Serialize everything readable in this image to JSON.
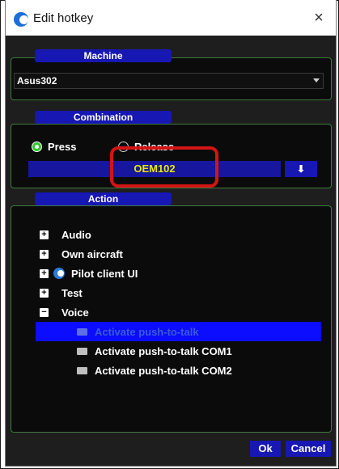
{
  "window": {
    "title": "Edit hotkey",
    "close_symbol": "×"
  },
  "machine": {
    "group_title": "Machine",
    "selected": "Asus302"
  },
  "combination": {
    "group_title": "Combination",
    "press_label": "Press",
    "release_label": "Release",
    "press_checked": true,
    "key_value": "OEM102",
    "select_key_symbol": "⬇"
  },
  "action": {
    "group_title": "Action",
    "tree": [
      {
        "label": "Audio",
        "toggle": "+"
      },
      {
        "label": "Own aircraft",
        "toggle": "+"
      },
      {
        "label": "Pilot client UI",
        "toggle": "+",
        "icon": "app-icon"
      },
      {
        "label": "Test",
        "toggle": "+"
      },
      {
        "label": "Voice",
        "toggle": "−"
      },
      {
        "label": "Activate push-to-talk",
        "icon": "keyboard-icon",
        "selected": true
      },
      {
        "label": "Activate push-to-talk COM1",
        "icon": "keyboard-icon"
      },
      {
        "label": "Activate push-to-talk COM2",
        "icon": "keyboard-icon"
      }
    ]
  },
  "buttons": {
    "ok": "Ok",
    "cancel": "Cancel"
  },
  "colors": {
    "panel_background": "#0b0b0b",
    "group_border": "#3f7a3f",
    "accent_blue": "#1717b3",
    "key_text_yellow": "#e8e800",
    "highlight_red": "#d41414",
    "selection_blue": "#0c0cff"
  }
}
